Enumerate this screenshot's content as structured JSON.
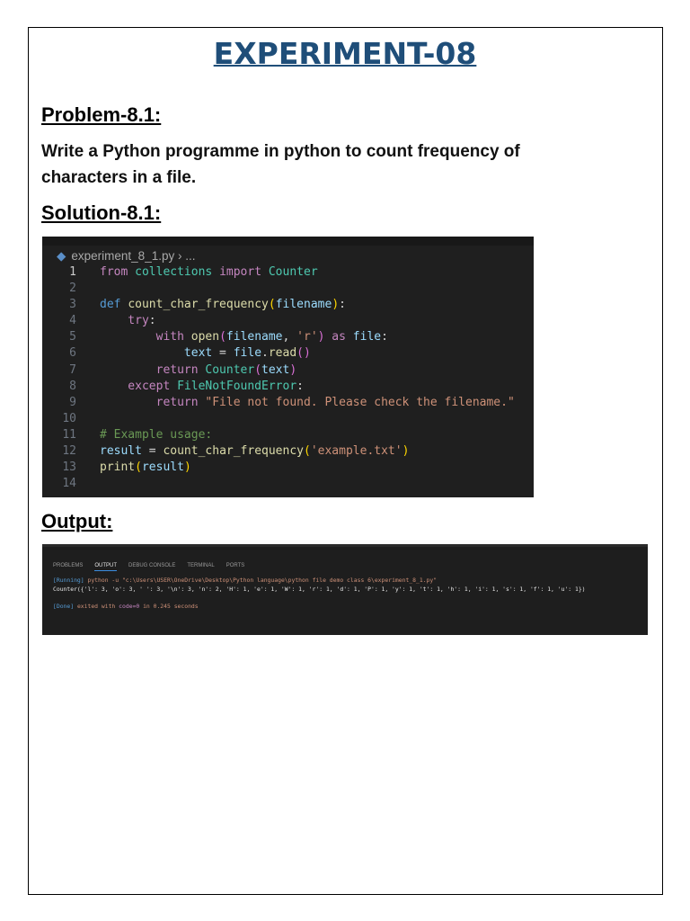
{
  "title": "EXPERIMENT-08",
  "problem_heading": "Problem-8.1:",
  "problem_text": "Write a Python programme in python to count frequency of characters in a file.",
  "solution_heading": "Solution-8.1:",
  "output_heading": "Output:",
  "editor": {
    "breadcrumb_file": "experiment_8_1.py",
    "breadcrumb_rest": "› ...",
    "lines": [
      [
        [
          "from ",
          "#c586c0"
        ],
        [
          "collections ",
          "#4ec9b0"
        ],
        [
          "import ",
          "#c586c0"
        ],
        [
          "Counter",
          "#4ec9b0"
        ]
      ],
      [],
      [
        [
          "def ",
          "#569cd6"
        ],
        [
          "count_char_frequency",
          "#dcdcaa"
        ],
        [
          "(",
          "#ffd700"
        ],
        [
          "filename",
          "#9cdcfe"
        ],
        [
          ")",
          "#ffd700"
        ],
        [
          ":",
          "#d4d4d4"
        ]
      ],
      [
        [
          "    try",
          "#c586c0"
        ],
        [
          ":",
          "#d4d4d4"
        ]
      ],
      [
        [
          "        with ",
          "#c586c0"
        ],
        [
          "open",
          "#dcdcaa"
        ],
        [
          "(",
          "#da70d6"
        ],
        [
          "filename",
          "#9cdcfe"
        ],
        [
          ", ",
          "#d4d4d4"
        ],
        [
          "'r'",
          "#ce9178"
        ],
        [
          ")",
          "#da70d6"
        ],
        [
          " as ",
          "#c586c0"
        ],
        [
          "file",
          "#9cdcfe"
        ],
        [
          ":",
          "#d4d4d4"
        ]
      ],
      [
        [
          "            text",
          "#9cdcfe"
        ],
        [
          " = ",
          "#d4d4d4"
        ],
        [
          "file",
          "#9cdcfe"
        ],
        [
          ".",
          "#d4d4d4"
        ],
        [
          "read",
          "#dcdcaa"
        ],
        [
          "()",
          "#da70d6"
        ]
      ],
      [
        [
          "        return ",
          "#c586c0"
        ],
        [
          "Counter",
          "#4ec9b0"
        ],
        [
          "(",
          "#da70d6"
        ],
        [
          "text",
          "#9cdcfe"
        ],
        [
          ")",
          "#da70d6"
        ]
      ],
      [
        [
          "    except ",
          "#c586c0"
        ],
        [
          "FileNotFoundError",
          "#4ec9b0"
        ],
        [
          ":",
          "#d4d4d4"
        ]
      ],
      [
        [
          "        return ",
          "#c586c0"
        ],
        [
          "\"File not found. Please check the filename.\"",
          "#ce9178"
        ]
      ],
      [],
      [
        [
          "# Example usage:",
          "#6a9955"
        ]
      ],
      [
        [
          "result",
          "#9cdcfe"
        ],
        [
          " = ",
          "#d4d4d4"
        ],
        [
          "count_char_frequency",
          "#dcdcaa"
        ],
        [
          "(",
          "#ffd700"
        ],
        [
          "'example.txt'",
          "#ce9178"
        ],
        [
          ")",
          "#ffd700"
        ]
      ],
      [
        [
          "print",
          "#dcdcaa"
        ],
        [
          "(",
          "#ffd700"
        ],
        [
          "result",
          "#9cdcfe"
        ],
        [
          ")",
          "#ffd700"
        ]
      ],
      []
    ]
  },
  "output_panel": {
    "tabs": [
      "PROBLEMS",
      "OUTPUT",
      "DEBUG CONSOLE",
      "TERMINAL",
      "PORTS"
    ],
    "running_tag": "[Running]",
    "command": " python -u \"c:\\Users\\USER\\OneDrive\\Desktop\\Python language\\python file demo class 6\\experiment_8_1.py\"",
    "result": "Counter({'l': 3, 'o': 3, ' ': 3, '\\n': 3, 'n': 2, 'H': 1, 'e': 1, 'W': 1, 'r': 1, 'd': 1, 'P': 1, 'y': 1, 't': 1, 'h': 1, 'i': 1, 's': 1, 'f': 1, 'u': 1})",
    "done_tag": "[Done]",
    "done_text": " exited with ",
    "done_code": "code=0",
    "done_time": " in 0.245 seconds"
  }
}
